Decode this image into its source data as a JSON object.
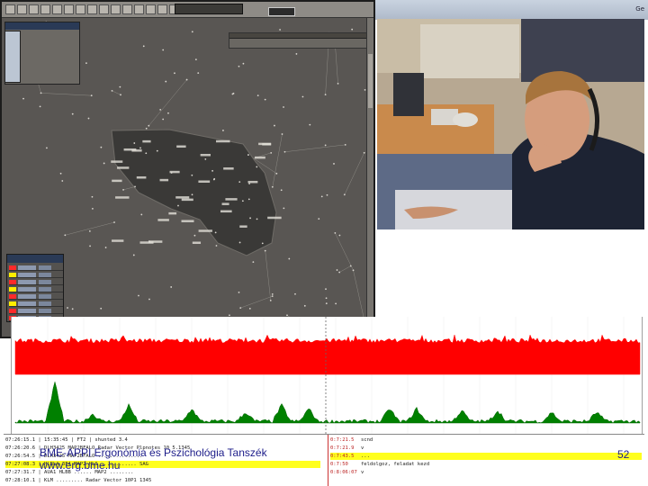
{
  "window": {
    "top_strip_label": "Ge"
  },
  "radar": {
    "toolbar_buttons": [
      "",
      "",
      "",
      "",
      "",
      "",
      "",
      "",
      "",
      "",
      "",
      "",
      "",
      "",
      "",
      ""
    ],
    "clock": "",
    "flight_list_title": "",
    "strip_panel_title": ""
  },
  "event_log": {
    "left_rows": [
      "07:26:15.1  |  15:35:45  |  FT2  |  shunted 3.4",
      "07:26:20.6  |  DLH3425 MAP2BFALO  Radar Vector Plpnotes 10 5.1345",
      "07:26:54.5  |  DLH3425 MAP2BFALO  ...............",
      "07:27:08.3  |  HLBLA 3F4  MAP2 HLS  ............ SAG",
      "07:27:31.7  |  AUA1 HLBB  ...... MAP2  ........ ",
      "07:28:10.1  |  KLM  ......... Radar Vector 10P1 1345"
    ],
    "right_rows": [
      {
        "time": "0:7:21.5",
        "text": "scnd"
      },
      {
        "time": "0:7:21.9",
        "text": "v"
      },
      {
        "time": "0:7:43.5",
        "text": "..."
      },
      {
        "time": "0:7:50",
        "text": "feldolgoz, feladat kezd"
      },
      {
        "time": "0:8:06:07",
        "text": "v"
      }
    ]
  },
  "footer": {
    "line1": "BME-APPI Ergonómia és Pszichológia  Tanszék",
    "line2": "www.erg.bme.hu",
    "slide_number": "52"
  },
  "colors": {
    "radar_bg": "#595653",
    "sector_fill": "#3a3937",
    "red_series": "#ff0000",
    "green_series": "#008000",
    "log_highlight": "#ffff1e",
    "footer_text": "#1d1d8a"
  }
}
